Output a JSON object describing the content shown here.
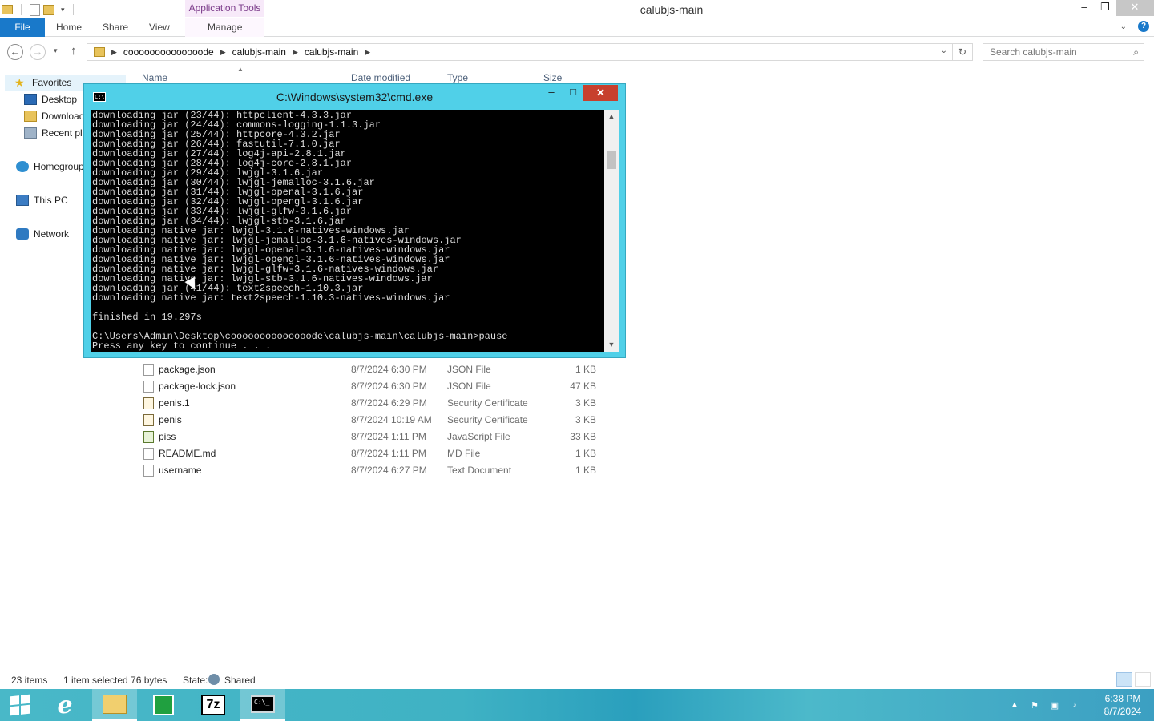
{
  "window": {
    "title": "calubjs-main",
    "contextual_tab_header": "Application Tools",
    "controls": {
      "minimize": "–",
      "restore": "❐",
      "close": "✕"
    }
  },
  "ribbon": {
    "tabs": [
      {
        "label": "File"
      },
      {
        "label": "Home"
      },
      {
        "label": "Share"
      },
      {
        "label": "View"
      },
      {
        "label": "Manage"
      }
    ],
    "help": "?"
  },
  "address": {
    "breadcrumbs": [
      "coooooooooooooode",
      "calubjs-main",
      "calubjs-main"
    ],
    "search_placeholder": "Search calubjs-main"
  },
  "nav": {
    "items": [
      {
        "label": "Favorites",
        "icon": "star-icon"
      },
      {
        "label": "Desktop",
        "icon": "desktop-icon"
      },
      {
        "label": "Downloads",
        "icon": "downloads-icon"
      },
      {
        "label": "Recent places",
        "icon": "recent-places-icon"
      },
      {
        "label": "Homegroup",
        "icon": "homegroup-icon"
      },
      {
        "label": "This PC",
        "icon": "this-pc-icon"
      },
      {
        "label": "Network",
        "icon": "network-icon"
      }
    ]
  },
  "columns": {
    "name": "Name",
    "date": "Date modified",
    "type": "Type",
    "size": "Size"
  },
  "files": [
    {
      "name": "package.json",
      "date": "8/7/2024 6:30 PM",
      "type": "JSON File",
      "size": "1 KB",
      "icon": "file-icon"
    },
    {
      "name": "package-lock.json",
      "date": "8/7/2024 6:30 PM",
      "type": "JSON File",
      "size": "47 KB",
      "icon": "file-icon"
    },
    {
      "name": "penis.1",
      "date": "8/7/2024 6:29 PM",
      "type": "Security Certificate",
      "size": "3 KB",
      "icon": "certificate-icon"
    },
    {
      "name": "penis",
      "date": "8/7/2024 10:19 AM",
      "type": "Security Certificate",
      "size": "3 KB",
      "icon": "certificate-icon"
    },
    {
      "name": "piss",
      "date": "8/7/2024 1:11 PM",
      "type": "JavaScript File",
      "size": "33 KB",
      "icon": "javascript-file-icon"
    },
    {
      "name": "README.md",
      "date": "8/7/2024 1:11 PM",
      "type": "MD File",
      "size": "1 KB",
      "icon": "file-icon"
    },
    {
      "name": "username",
      "date": "8/7/2024 6:27 PM",
      "type": "Text Document",
      "size": "1 KB",
      "icon": "text-file-icon"
    }
  ],
  "cmd": {
    "title": "C:\\Windows\\system32\\cmd.exe",
    "lines": [
      "downloading jar (23/44): httpclient-4.3.3.jar",
      "downloading jar (24/44): commons-logging-1.1.3.jar",
      "downloading jar (25/44): httpcore-4.3.2.jar",
      "downloading jar (26/44): fastutil-7.1.0.jar",
      "downloading jar (27/44): log4j-api-2.8.1.jar",
      "downloading jar (28/44): log4j-core-2.8.1.jar",
      "downloading jar (29/44): lwjgl-3.1.6.jar",
      "downloading jar (30/44): lwjgl-jemalloc-3.1.6.jar",
      "downloading jar (31/44): lwjgl-openal-3.1.6.jar",
      "downloading jar (32/44): lwjgl-opengl-3.1.6.jar",
      "downloading jar (33/44): lwjgl-glfw-3.1.6.jar",
      "downloading jar (34/44): lwjgl-stb-3.1.6.jar",
      "downloading native jar: lwjgl-3.1.6-natives-windows.jar",
      "downloading native jar: lwjgl-jemalloc-3.1.6-natives-windows.jar",
      "downloading native jar: lwjgl-openal-3.1.6-natives-windows.jar",
      "downloading native jar: lwjgl-opengl-3.1.6-natives-windows.jar",
      "downloading native jar: lwjgl-glfw-3.1.6-natives-windows.jar",
      "downloading native jar: lwjgl-stb-3.1.6-natives-windows.jar",
      "downloading jar (41/44): text2speech-1.10.3.jar",
      "downloading native jar: text2speech-1.10.3-natives-windows.jar",
      "",
      "finished in 19.297s",
      "",
      "C:\\Users\\Admin\\Desktop\\coooooooooooooode\\calubjs-main\\calubjs-main>pause",
      "Press any key to continue . . ."
    ]
  },
  "status": {
    "items_count": "23 items",
    "selection": "1 item selected  76 bytes",
    "state_label": "State:",
    "state_value": "Shared"
  },
  "taskbar": {
    "apps": [
      {
        "name": "internet-explorer-icon"
      },
      {
        "name": "file-explorer-icon"
      },
      {
        "name": "store-icon"
      },
      {
        "name": "7zip-icon",
        "label": "7z"
      },
      {
        "name": "cmd-icon"
      }
    ],
    "clock_time": "6:38 PM",
    "clock_date": "8/7/2024"
  },
  "colors": {
    "accent": "#1979ca",
    "cmd_frame": "#50d0e8",
    "close_red": "#c7402d",
    "taskbar": "#3fb2c4"
  }
}
